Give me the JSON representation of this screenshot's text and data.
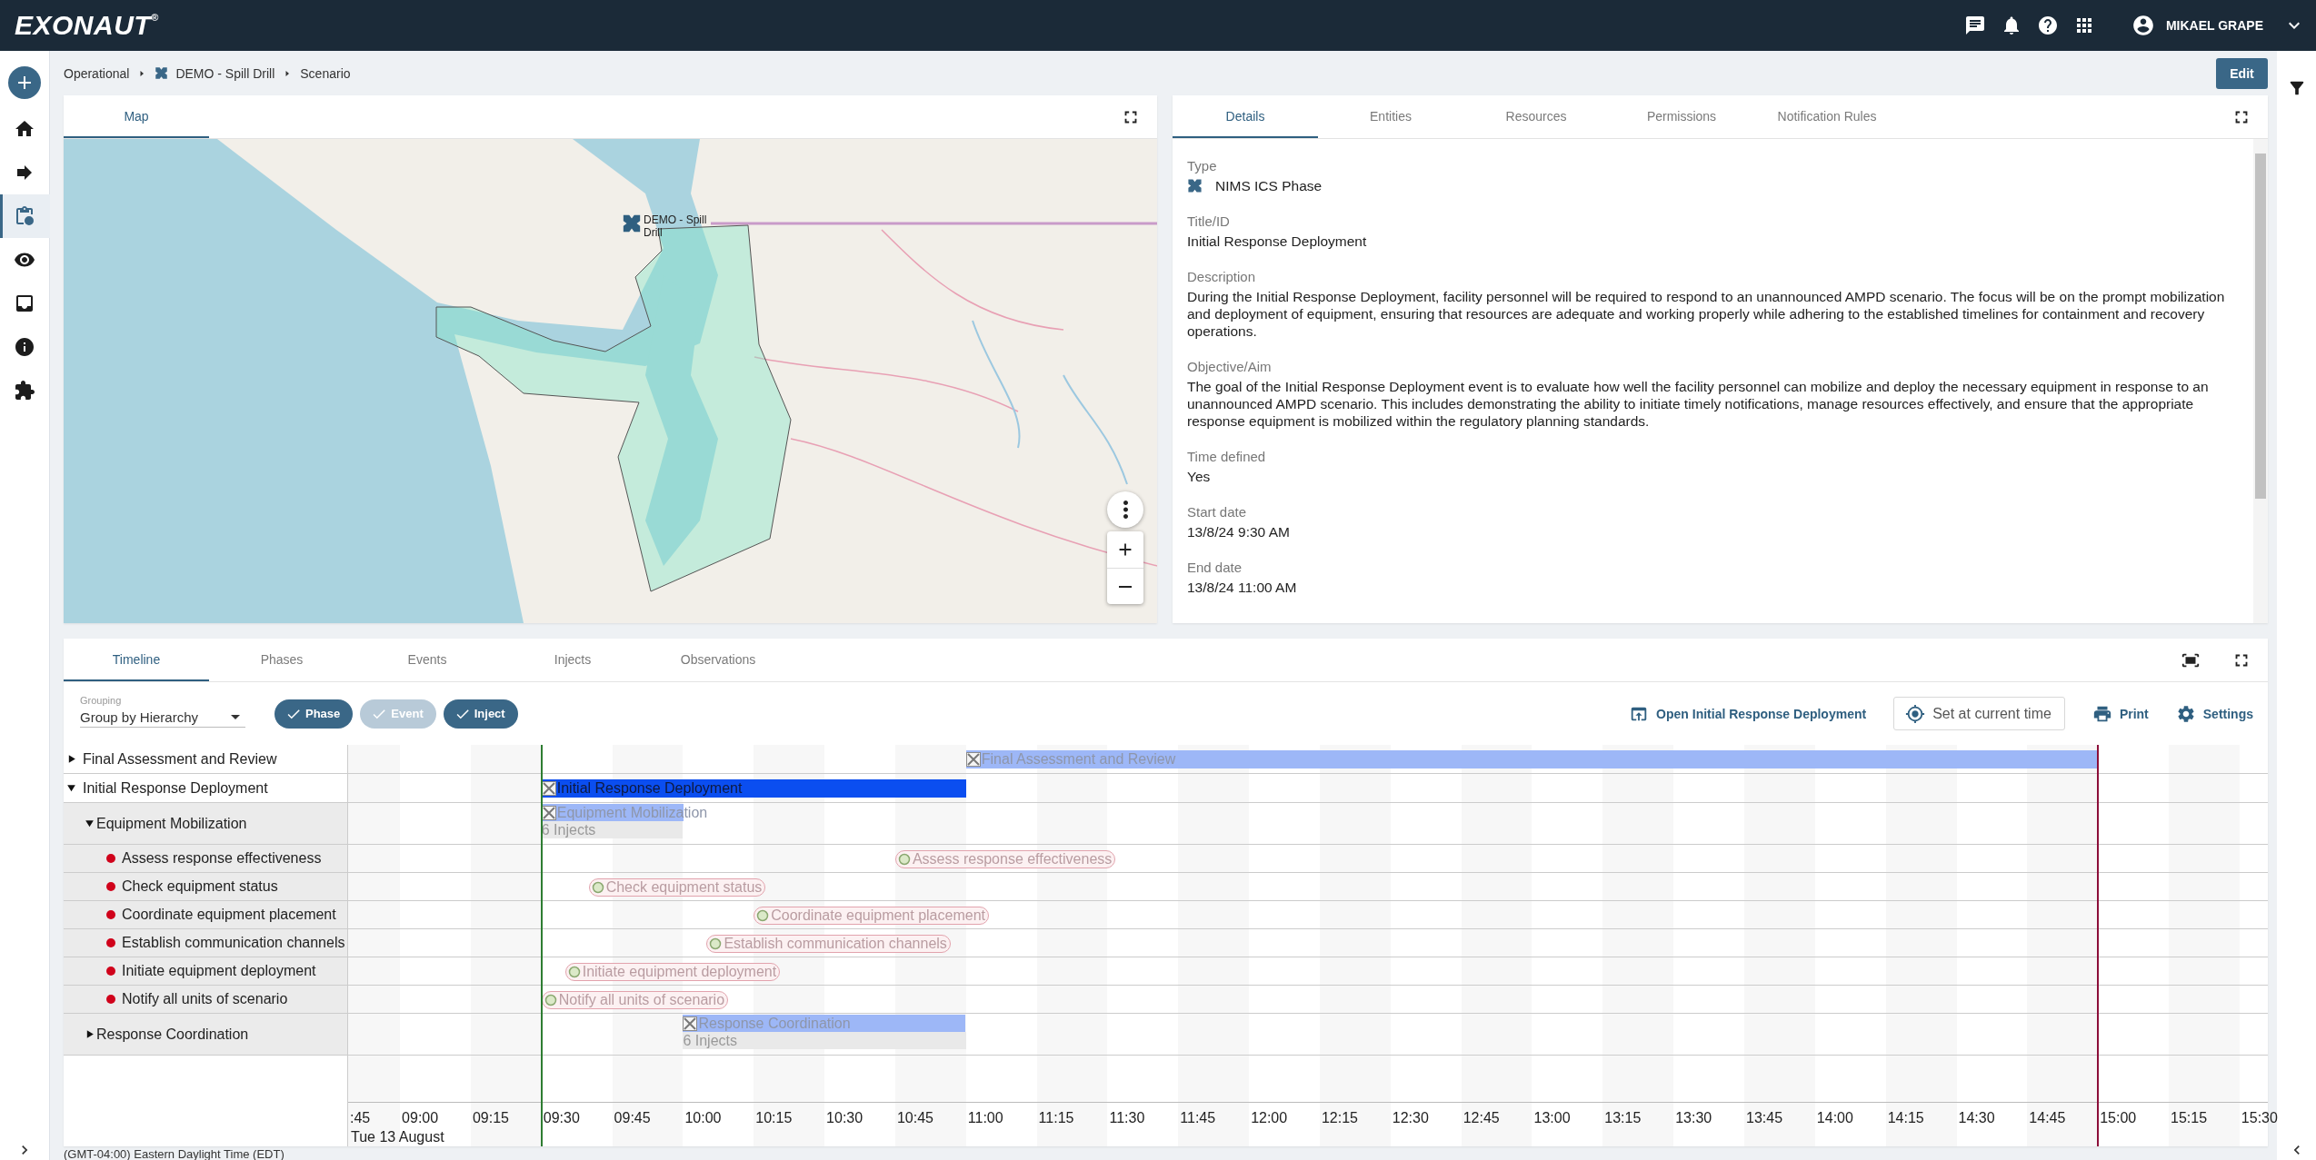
{
  "app": {
    "logo": "EXONAUT$^{®}$",
    "user": "MIKAEL GRAPE"
  },
  "nav": [
    {
      "kind": "home",
      "selected": false
    },
    {
      "kind": "arrow",
      "selected": false
    },
    {
      "kind": "clipboard",
      "selected": true
    },
    {
      "kind": "eye",
      "selected": false
    },
    {
      "kind": "inbox",
      "selected": false
    },
    {
      "kind": "info",
      "selected": false
    },
    {
      "kind": "puzzle",
      "selected": false
    }
  ],
  "breadcrumb": [
    {
      "kind": "plain",
      "label": "Operational"
    },
    {
      "kind": "scenario",
      "label": "DEMO - Spill Drill"
    },
    {
      "kind": "plain",
      "label": "Scenario"
    }
  ],
  "edit_button": "Edit",
  "map": {
    "tabs": [
      {
        "label": "Map",
        "selected": true
      }
    ],
    "marker": {
      "label": "DEMO - Spill Drill"
    }
  },
  "details": {
    "tabs": [
      {
        "label": "Details",
        "selected": true
      },
      {
        "label": "Entities",
        "selected": false
      },
      {
        "label": "Resources",
        "selected": false
      },
      {
        "label": "Permissions",
        "selected": false
      },
      {
        "label": "Notification Rules",
        "selected": false
      }
    ],
    "fields": [
      {
        "kind": "type",
        "label": "Type",
        "value": "NIMS ICS Phase"
      },
      {
        "kind": "text",
        "label": "Title/ID",
        "value": "Initial Response Deployment"
      },
      {
        "kind": "text",
        "label": "Description",
        "value": "During the Initial Response Deployment, facility personnel will be required to respond to an unannounced AMPD scenario. The focus will be on the prompt mobilization and deployment of equipment, ensuring that resources are adequate and working properly while adhering to the established timelines for containment and recovery operations."
      },
      {
        "kind": "text",
        "label": "Objective/Aim",
        "value": "The goal of the Initial Response Deployment event is to evaluate how well the facility personnel can mobilize and deploy the necessary equipment in response to an unannounced AMPD scenario. This includes demonstrating the ability to initiate timely notifications, manage resources effectively, and ensure that the appropriate response equipment is mobilized within the regulatory planning standards."
      },
      {
        "kind": "text",
        "label": "Time defined",
        "value": "Yes"
      },
      {
        "kind": "text",
        "label": "Start date",
        "value": "13/8/24 9:30 AM"
      },
      {
        "kind": "text",
        "label": "End date",
        "value": "13/8/24 11:00 AM"
      }
    ]
  },
  "timeline": {
    "tabs": [
      {
        "label": "Timeline",
        "selected": true
      },
      {
        "label": "Phases",
        "selected": false
      },
      {
        "label": "Events",
        "selected": false
      },
      {
        "label": "Injects",
        "selected": false
      },
      {
        "label": "Observations",
        "selected": false
      }
    ],
    "grouping": {
      "label": "Grouping",
      "value": "Group by Hierarchy"
    },
    "filters": [
      {
        "label": "Phase",
        "checked": true
      },
      {
        "label": "Event",
        "checked": false
      },
      {
        "label": "Inject",
        "checked": true
      }
    ],
    "actions": [
      {
        "kind": "open",
        "label": "Open Initial Response Deployment"
      },
      {
        "kind": "target",
        "label": "Set at current time"
      },
      {
        "kind": "print",
        "label": "Print"
      },
      {
        "kind": "settings",
        "label": "Settings"
      }
    ],
    "rows": [
      {
        "kind": "phase",
        "label": "Final Assessment and Review",
        "expanded": false,
        "selected": false,
        "bar_label": "Final Assessment and Review"
      },
      {
        "kind": "phase",
        "label": "Initial Response Deployment",
        "expanded": true,
        "selected": true,
        "bar_label": "Initial Response Deployment",
        "children": [
          {
            "kind": "group",
            "label": "Equipment Mobilization",
            "expanded": true,
            "selected": false,
            "bar_label": "Equipment Mobilization",
            "count": "6 Injects",
            "children": [
              {
                "kind": "inject",
                "label": "Assess response effectiveness",
                "selected": false,
                "bar_label": "Assess response effectiveness"
              },
              {
                "kind": "inject",
                "label": "Check equipment status",
                "selected": false,
                "bar_label": "Check equipment status"
              },
              {
                "kind": "inject",
                "label": "Coordinate equipment placement",
                "selected": false,
                "bar_label": "Coordinate equipment placement"
              },
              {
                "kind": "inject",
                "label": "Establish communication channels",
                "selected": false,
                "bar_label": "Establish communication channels"
              },
              {
                "kind": "inject",
                "label": "Initiate equipment deployment",
                "selected": false,
                "bar_label": "Initiate equipment deployment"
              },
              {
                "kind": "inject",
                "label": "Notify all units of scenario",
                "selected": false,
                "bar_label": "Notify all units of scenario"
              }
            ]
          },
          {
            "kind": "group",
            "label": "Response Coordination",
            "expanded": false,
            "selected": false,
            "bar_label": "Response Coordination",
            "count": "6 Injects"
          }
        ]
      }
    ],
    "axis": {
      "ticks": [
        ":45",
        "09:00",
        "09:15",
        "09:30",
        "09:45",
        "10:00",
        "10:15",
        "10:30",
        "10:45",
        "11:00",
        "11:15",
        "11:30",
        "11:45",
        "12:00",
        "12:15",
        "12:30",
        "12:45",
        "13:00",
        "13:15",
        "13:30",
        "13:45",
        "14:00",
        "14:15",
        "14:30",
        "14:45",
        "15:00",
        "15:15",
        "15:30"
      ],
      "date": "Tue 13 August"
    },
    "timezone": "(GMT-04:00) Eastern Daylight Time (EDT)"
  }
}
